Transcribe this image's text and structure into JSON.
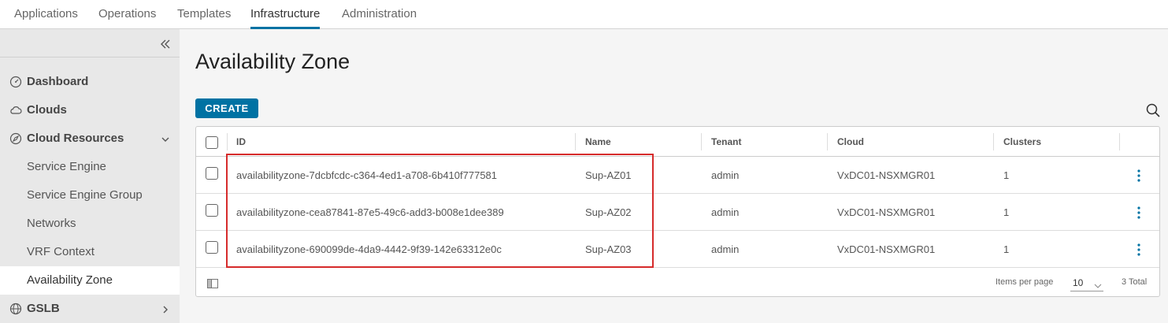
{
  "topnav": {
    "tabs": [
      {
        "label": "Applications"
      },
      {
        "label": "Operations"
      },
      {
        "label": "Templates"
      },
      {
        "label": "Infrastructure"
      },
      {
        "label": "Administration"
      }
    ],
    "active_tab": "Infrastructure",
    "accent_color": "#0072a3"
  },
  "sidebar": {
    "collapse_icon": "double-chevron-left-icon",
    "items": [
      {
        "label": "Dashboard",
        "icon": "speedometer-icon"
      },
      {
        "label": "Clouds",
        "icon": "cloud-icon"
      },
      {
        "label": "Cloud Resources",
        "icon": "compass-icon",
        "expanded": true,
        "children": [
          {
            "label": "Service Engine"
          },
          {
            "label": "Service Engine Group"
          },
          {
            "label": "Networks"
          },
          {
            "label": "VRF Context"
          },
          {
            "label": "Availability Zone",
            "active": true
          }
        ]
      },
      {
        "label": "GSLB",
        "icon": "globe-icon",
        "expanded": false
      }
    ]
  },
  "main": {
    "title": "Availability Zone",
    "create_label": "CREATE",
    "search_icon": "search-icon"
  },
  "grid": {
    "columns": [
      "ID",
      "Name",
      "Tenant",
      "Cloud",
      "Clusters"
    ],
    "rows": [
      {
        "id": "availabilityzone-7dcbfcdc-c364-4ed1-a708-6b410f777581",
        "name": "Sup-AZ01",
        "tenant": "admin",
        "cloud": "VxDC01-NSXMGR01",
        "clusters": "1"
      },
      {
        "id": "availabilityzone-cea87841-87e5-49c6-add3-b008e1dee389",
        "name": "Sup-AZ02",
        "tenant": "admin",
        "cloud": "VxDC01-NSXMGR01",
        "clusters": "1"
      },
      {
        "id": "availabilityzone-690099de-4da9-4442-9f39-142e63312e0c",
        "name": "Sup-AZ03",
        "tenant": "admin",
        "cloud": "VxDC01-NSXMGR01",
        "clusters": "1"
      }
    ],
    "footer": {
      "items_per_page_label": "Items per page",
      "items_per_page_value": "10",
      "total": "3 Total"
    }
  },
  "highlight_color": "#d62b2b"
}
